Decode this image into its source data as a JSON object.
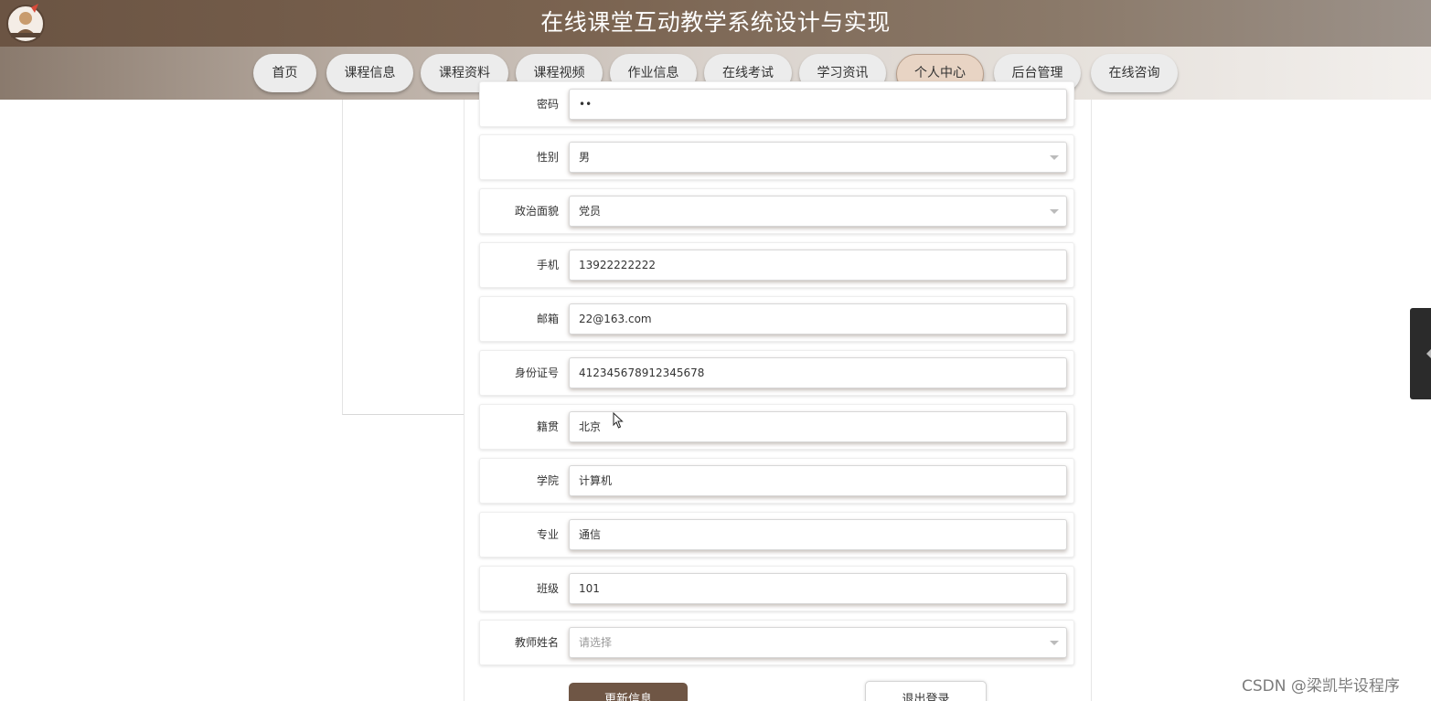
{
  "header": {
    "title": "在线课堂互动教学系统设计与实现",
    "logo_icon": "mascot-logo-icon"
  },
  "nav": {
    "items": [
      {
        "label": "首页"
      },
      {
        "label": "课程信息"
      },
      {
        "label": "课程资料"
      },
      {
        "label": "课程视频"
      },
      {
        "label": "作业信息"
      },
      {
        "label": "在线考试"
      },
      {
        "label": "学习资讯"
      },
      {
        "label": "个人中心",
        "active": true
      },
      {
        "label": "后台管理"
      },
      {
        "label": "在线咨询"
      }
    ]
  },
  "form": {
    "password": {
      "label": "密码",
      "value": "••"
    },
    "gender": {
      "label": "性别",
      "value": "男"
    },
    "political_status": {
      "label": "政治面貌",
      "value": "党员"
    },
    "phone": {
      "label": "手机",
      "value": "13922222222"
    },
    "email": {
      "label": "邮箱",
      "value": "22@163.com"
    },
    "id_number": {
      "label": "身份证号",
      "value": "412345678912345678"
    },
    "hometown": {
      "label": "籍贯",
      "value": "北京"
    },
    "college": {
      "label": "学院",
      "value": "计算机"
    },
    "major": {
      "label": "专业",
      "value": "通信"
    },
    "class": {
      "label": "班级",
      "value": "101"
    },
    "teacher_name": {
      "label": "教师姓名",
      "placeholder": "请选择"
    }
  },
  "actions": {
    "update_label": "更新信息",
    "logout_label": "退出登录"
  },
  "watermark": "CSDN @梁凯毕设程序",
  "colors": {
    "header": "#6b5443",
    "active_tab": "#e8d4c4",
    "primary_button": "#6f5645"
  }
}
